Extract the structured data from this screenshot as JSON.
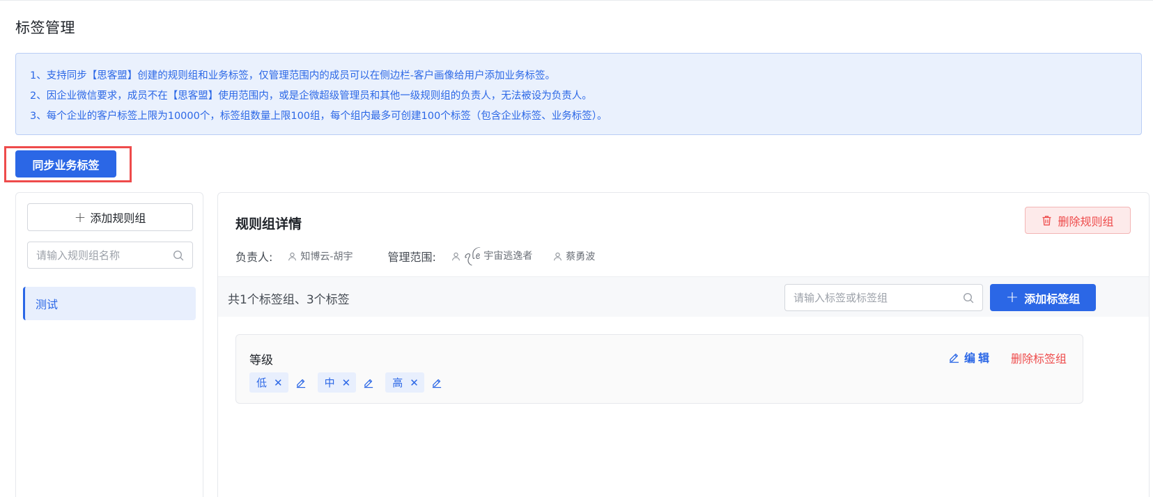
{
  "page": {
    "title": "标签管理"
  },
  "notice": {
    "lines": [
      "1、支持同步【思客盟】创建的规则组和业务标签，仅管理范围内的成员可以在侧边栏-客户画像给用户添加业务标签。",
      "2、因企业微信要求，成员不在【思客盟】使用范围内，或是企微超级管理员和其他一级规则组的负责人，无法被设为负责人。",
      "3、每个企业的客户标签上限为10000个，标签组数量上限100组，每个组内最多可创建100个标签（包含企业标签、业务标签）。"
    ]
  },
  "sync_button": {
    "label": "同步业务标签"
  },
  "left_panel": {
    "add_group_label": "添加规则组",
    "search_placeholder": "请输入规则组名称",
    "groups": [
      {
        "label": "测试",
        "selected": true
      }
    ]
  },
  "detail": {
    "title": "规则组详情",
    "delete_group_label": "删除规则组",
    "owner_label": "负责人:",
    "owners": [
      "知博云-胡宇"
    ],
    "scope_label": "管理范围:",
    "scope_members": [
      "ꪖꪶꫀ 宇宙逃逸者",
      "蔡勇波"
    ],
    "count_text": "共1个标签组、3个标签",
    "tag_search_placeholder": "请输入标签或标签组",
    "add_tag_group_label": "添加标签组",
    "tag_groups": [
      {
        "name": "等级",
        "edit_label": "编辑",
        "delete_label": "删除标签组",
        "tags": [
          "低",
          "中",
          "高"
        ]
      }
    ]
  },
  "colors": {
    "primary": "#2b67e6",
    "danger": "#ee4b4b",
    "notice_bg": "#eaf1fd",
    "highlight_box": "#ee4b4b"
  }
}
